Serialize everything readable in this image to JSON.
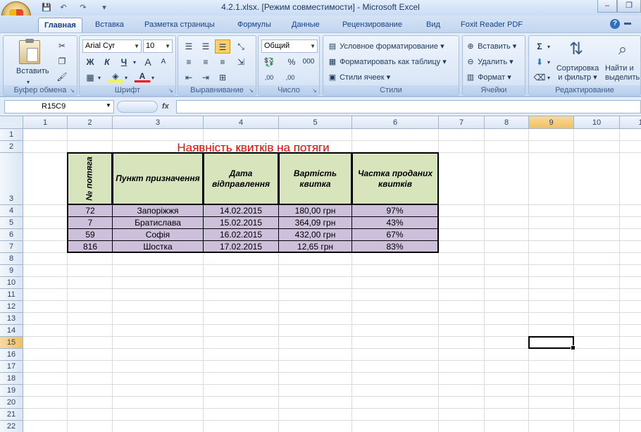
{
  "window": {
    "title": "4.2.1.xlsx.  [Режим совместимости] - Microsoft Excel",
    "minimize": "–",
    "restore": "❐"
  },
  "quick_access": {
    "save": "💾",
    "undo": "↶",
    "redo": "↷",
    "more": "▾"
  },
  "tabs": [
    "Главная",
    "Вставка",
    "Разметка страницы",
    "Формулы",
    "Данные",
    "Рецензирование",
    "Вид",
    "Foxit Reader PDF"
  ],
  "ribbon": {
    "clipboard": {
      "paste": "Вставить",
      "label": "Буфер обмена"
    },
    "font": {
      "name": "Arial Cyr",
      "size": "10",
      "bold": "Ж",
      "italic": "К",
      "underline": "Ч",
      "grow": "A",
      "shrink": "A",
      "fontcolor": "A",
      "label": "Шрифт"
    },
    "alignment": {
      "label": "Выравнивание"
    },
    "number": {
      "format": "Общий",
      "percent": "%",
      "thousands": "000",
      "inc_dec": ",00",
      "dec_dec": ",00",
      "label": "Число"
    },
    "styles": {
      "conditional": "Условное форматирование",
      "as_table": "Форматировать как таблицу",
      "cell_styles": "Стили ячеек",
      "label": "Стили"
    },
    "cells": {
      "insert": "Вставить",
      "delete": "Удалить",
      "format": "Формат",
      "label": "Ячейки"
    },
    "editing": {
      "sum": "Σ",
      "sort_line1": "Сортировка",
      "sort_line2": "и фильтр",
      "find_line1": "Найти и",
      "find_line2": "выделить",
      "label": "Редактирование"
    }
  },
  "formula_bar": {
    "name_box": "R15C9",
    "fx": "fx",
    "value": ""
  },
  "sheet": {
    "columns": [
      "1",
      "2",
      "3",
      "4",
      "5",
      "6",
      "7",
      "8",
      "9",
      "10",
      "1"
    ],
    "rows": [
      "1",
      "2",
      "3",
      "4",
      "5",
      "6",
      "7",
      "8",
      "9",
      "10",
      "11",
      "12",
      "13",
      "14",
      "15",
      "16",
      "17",
      "18",
      "19",
      "20",
      "21",
      "22"
    ],
    "selected_column": "9",
    "selected_row": "15",
    "table_title": "Наявність квитків на потяги",
    "headers": [
      "№ потяга",
      "Пункт призначення",
      "Дата відправлення",
      "Вартість квитка",
      "Частка проданих квитків"
    ],
    "data": [
      [
        "72",
        "Запоріжжя",
        "14.02.2015",
        "180,00 грн",
        "97%"
      ],
      [
        "7",
        "Братислава",
        "15.02.2015",
        "364,09 грн",
        "43%"
      ],
      [
        "59",
        "Софія",
        "16.02.2015",
        "432,00 грн",
        "67%"
      ],
      [
        "816",
        "Шостка",
        "17.02.2015",
        "12,65 грн",
        "83%"
      ]
    ]
  },
  "colors": {
    "header_fill": "#d8e4bc",
    "data_fill": "#ccc0da",
    "title_color": "#ff0000"
  }
}
